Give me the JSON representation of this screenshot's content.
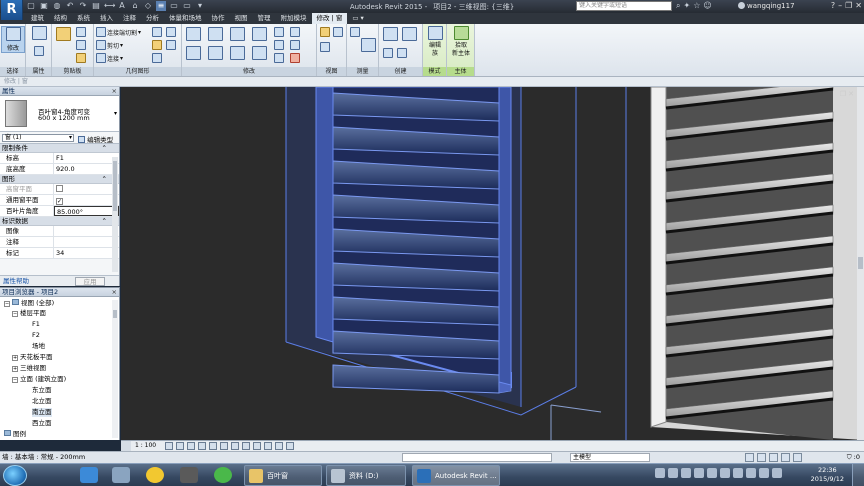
{
  "app": {
    "logo": "R",
    "title": "Autodesk Revit 2015 -",
    "document": "项目2 - 三维视图: {三维}",
    "search_placeholder": "键入关键字或短语",
    "user": "wangqing117",
    "colors": {
      "accent": "#2b6fb8",
      "contextual_tab": "#79b848",
      "title_bg": "#2f353d"
    }
  },
  "menu_tabs": [
    "建筑",
    "结构",
    "系统",
    "插入",
    "注释",
    "分析",
    "体量和场地",
    "协作",
    "视图",
    "管理",
    "附加模块",
    "修改 | 窗",
    "▭ ▾"
  ],
  "ribbon": {
    "panels": {
      "select": "选择",
      "properties": "属性",
      "clipboard": "剪贴板",
      "geometry": "几何图形",
      "modify": "修改",
      "view": "视图",
      "measure": "测量",
      "create": "创建",
      "mode": "模式",
      "host": "主体"
    },
    "buttons": {
      "modify": "修改",
      "cut": "连接端切割",
      "cutting": "剪切",
      "join": "连接",
      "edit_family": "编辑\n族",
      "pick_host": "拾取\n新主体"
    }
  },
  "options_bar": "修改 | 窗",
  "properties": {
    "header": "属性",
    "close": "×",
    "type_name_1": "百叶窗4-角度可变",
    "type_name_2": "600 x 1200 mm",
    "instance_selector": "窗 (1)",
    "edit_type": "编辑类型",
    "sections": [
      {
        "title": "限制条件",
        "rows": [
          {
            "key": "标高",
            "value": "F1"
          },
          {
            "key": "底高度",
            "value": "920.0"
          }
        ]
      },
      {
        "title": "图形",
        "rows": [
          {
            "key": "高窗平面",
            "value": ""
          },
          {
            "key": "通用窗平面",
            "value": "✓"
          },
          {
            "key": "百叶片角度",
            "value": "85.000°"
          }
        ]
      },
      {
        "title": "标识数据",
        "rows": [
          {
            "key": "图像",
            "value": ""
          },
          {
            "key": "注释",
            "value": ""
          },
          {
            "key": "标记",
            "value": "34"
          }
        ]
      }
    ],
    "help_link": "属性帮助",
    "apply": "应用"
  },
  "browser": {
    "header": "项目浏览器 - 项目2",
    "close": "×",
    "nodes": [
      {
        "label": "视图 (全部)",
        "toggle": "−"
      },
      {
        "label": "楼层平面",
        "toggle": "−"
      },
      {
        "label": "F1",
        "toggle": ""
      },
      {
        "label": "F2",
        "toggle": ""
      },
      {
        "label": "场地",
        "toggle": ""
      },
      {
        "label": "天花板平面",
        "toggle": "+"
      },
      {
        "label": "三维视图",
        "toggle": "+"
      },
      {
        "label": "立面 (建筑立面)",
        "toggle": "−"
      },
      {
        "label": "东立面",
        "toggle": ""
      },
      {
        "label": "北立面",
        "toggle": ""
      },
      {
        "label": "南立面",
        "toggle": ""
      },
      {
        "label": "西立面",
        "toggle": ""
      },
      {
        "label": "图例",
        "toggle": ""
      }
    ]
  },
  "view_control": {
    "scale": "1 : 100"
  },
  "status": {
    "message": "墙 : 基本墙 : 常规 - 200mm",
    "model": "主模型",
    "filter": ":0"
  },
  "taskbar": {
    "tasks": [
      "百叶窗",
      "资料 (D:)",
      "Autodesk Revit ..."
    ],
    "time": "22:36",
    "date": "2015/9/12"
  }
}
